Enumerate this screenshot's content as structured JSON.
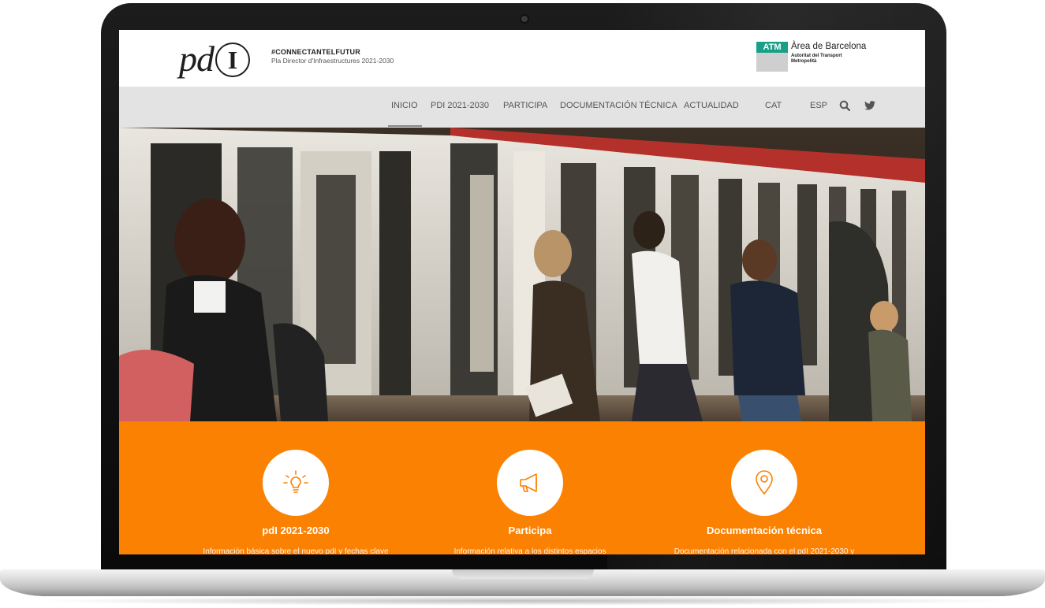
{
  "header": {
    "logo": {
      "pd": "pd",
      "letter": "I"
    },
    "tagline_main": "#CONNECTANTELFUTUR",
    "tagline_sub": "Pla Director d'Infraestructures 2021-2030",
    "atm": {
      "badge": "ATM",
      "title": "Àrea de Barcelona",
      "sub1": "Autoritat del Transport",
      "sub2": "Metropolità"
    }
  },
  "nav": {
    "items": [
      "INICIO",
      "PDI 2021-2030",
      "PARTICIPA",
      "DOCUMENTACIÓN TÉCNICA",
      "ACTUALIDAD"
    ],
    "active": "INICIO",
    "languages": [
      "CAT",
      "ESP"
    ],
    "icons": [
      "search-icon",
      "twitter-icon"
    ]
  },
  "hero": {
    "subject": "commuters boarding a metro train"
  },
  "features": [
    {
      "icon": "lightbulb-icon",
      "title": "pdI 2021-2030",
      "desc": "Información básica sobre el nuevo pdI y fechas clave"
    },
    {
      "icon": "megaphone-icon",
      "title": "Participa",
      "desc": "Información relativa a los distintos espacios"
    },
    {
      "icon": "location-pin-icon",
      "title": "Documentación técnica",
      "desc": "Documentación relacionada con el pdI 2021-2030 y"
    }
  ],
  "colors": {
    "accent": "#fb8102",
    "nav_bg": "#e3e3e3",
    "atm_green": "#1aa087"
  }
}
